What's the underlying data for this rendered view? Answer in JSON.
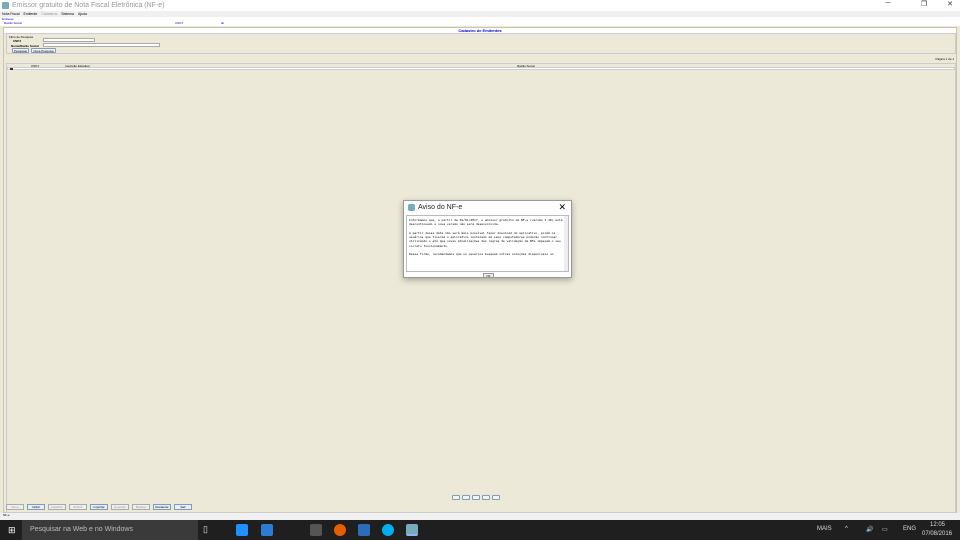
{
  "window": {
    "title": "Emissor gratuito de Nota Fiscal Eletrônica (NF-e)"
  },
  "menu": [
    "Nota Fiscal",
    "Emitente",
    "Cadastros",
    "Sistema",
    "Ajuda"
  ],
  "emitter": {
    "label": "Emitente",
    "name_label": "Razão Social",
    "cnpj_label": "CNPJ",
    "ie_label": "IE"
  },
  "screen": {
    "title": "Cadastro de Emitentes",
    "filter_title": "Filtro de Pesquisa",
    "cnpj_label": "CNPJ",
    "name_label": "Nome/Razão Social",
    "search": "Pesquisar",
    "new_search": "Nova Pesquisa",
    "page": "Página 1 de 1"
  },
  "columns": [
    "CNPJ",
    "Inscrição Estadual",
    "Razão Social"
  ],
  "dialog": {
    "title": "Aviso do NF-e",
    "text": "Informamos que, a partir de 01/01/2017, o emissor gratuito de NF-e (versão 3.10) está descontinuado e nova versão não será desenvolvida.\n\nA partir dessa data não será mais possível fazer download do aplicativo, porém os usuários que tiverem o aplicativo instalado em seus computadores poderão continuar utilizando-o até que novas atualizações das regras de validação da NFe impeçam o seu correto funcionamento.\n\nDessa forma, recomendamos que os usuários busquem outras soluções disponíveis no",
    "ok": "OK"
  },
  "buttons": [
    {
      "label": "Novo",
      "enabled": false
    },
    {
      "label": "Incluir",
      "enabled": true
    },
    {
      "label": "Detalhar",
      "enabled": false
    },
    {
      "label": "Excluir",
      "enabled": false
    },
    {
      "label": "Importar",
      "enabled": true
    },
    {
      "label": "Exportar",
      "enabled": false
    },
    {
      "label": "Backup",
      "enabled": false
    },
    {
      "label": "Restaurar",
      "enabled": true
    },
    {
      "label": "Sair",
      "enabled": true
    }
  ],
  "statusbar": "NF-e",
  "taskbar": {
    "search": "Pesquisar na Web e no Windows",
    "more": "MAIS",
    "lang": "ENG",
    "time": "12:05",
    "date": "07/08/2016"
  }
}
